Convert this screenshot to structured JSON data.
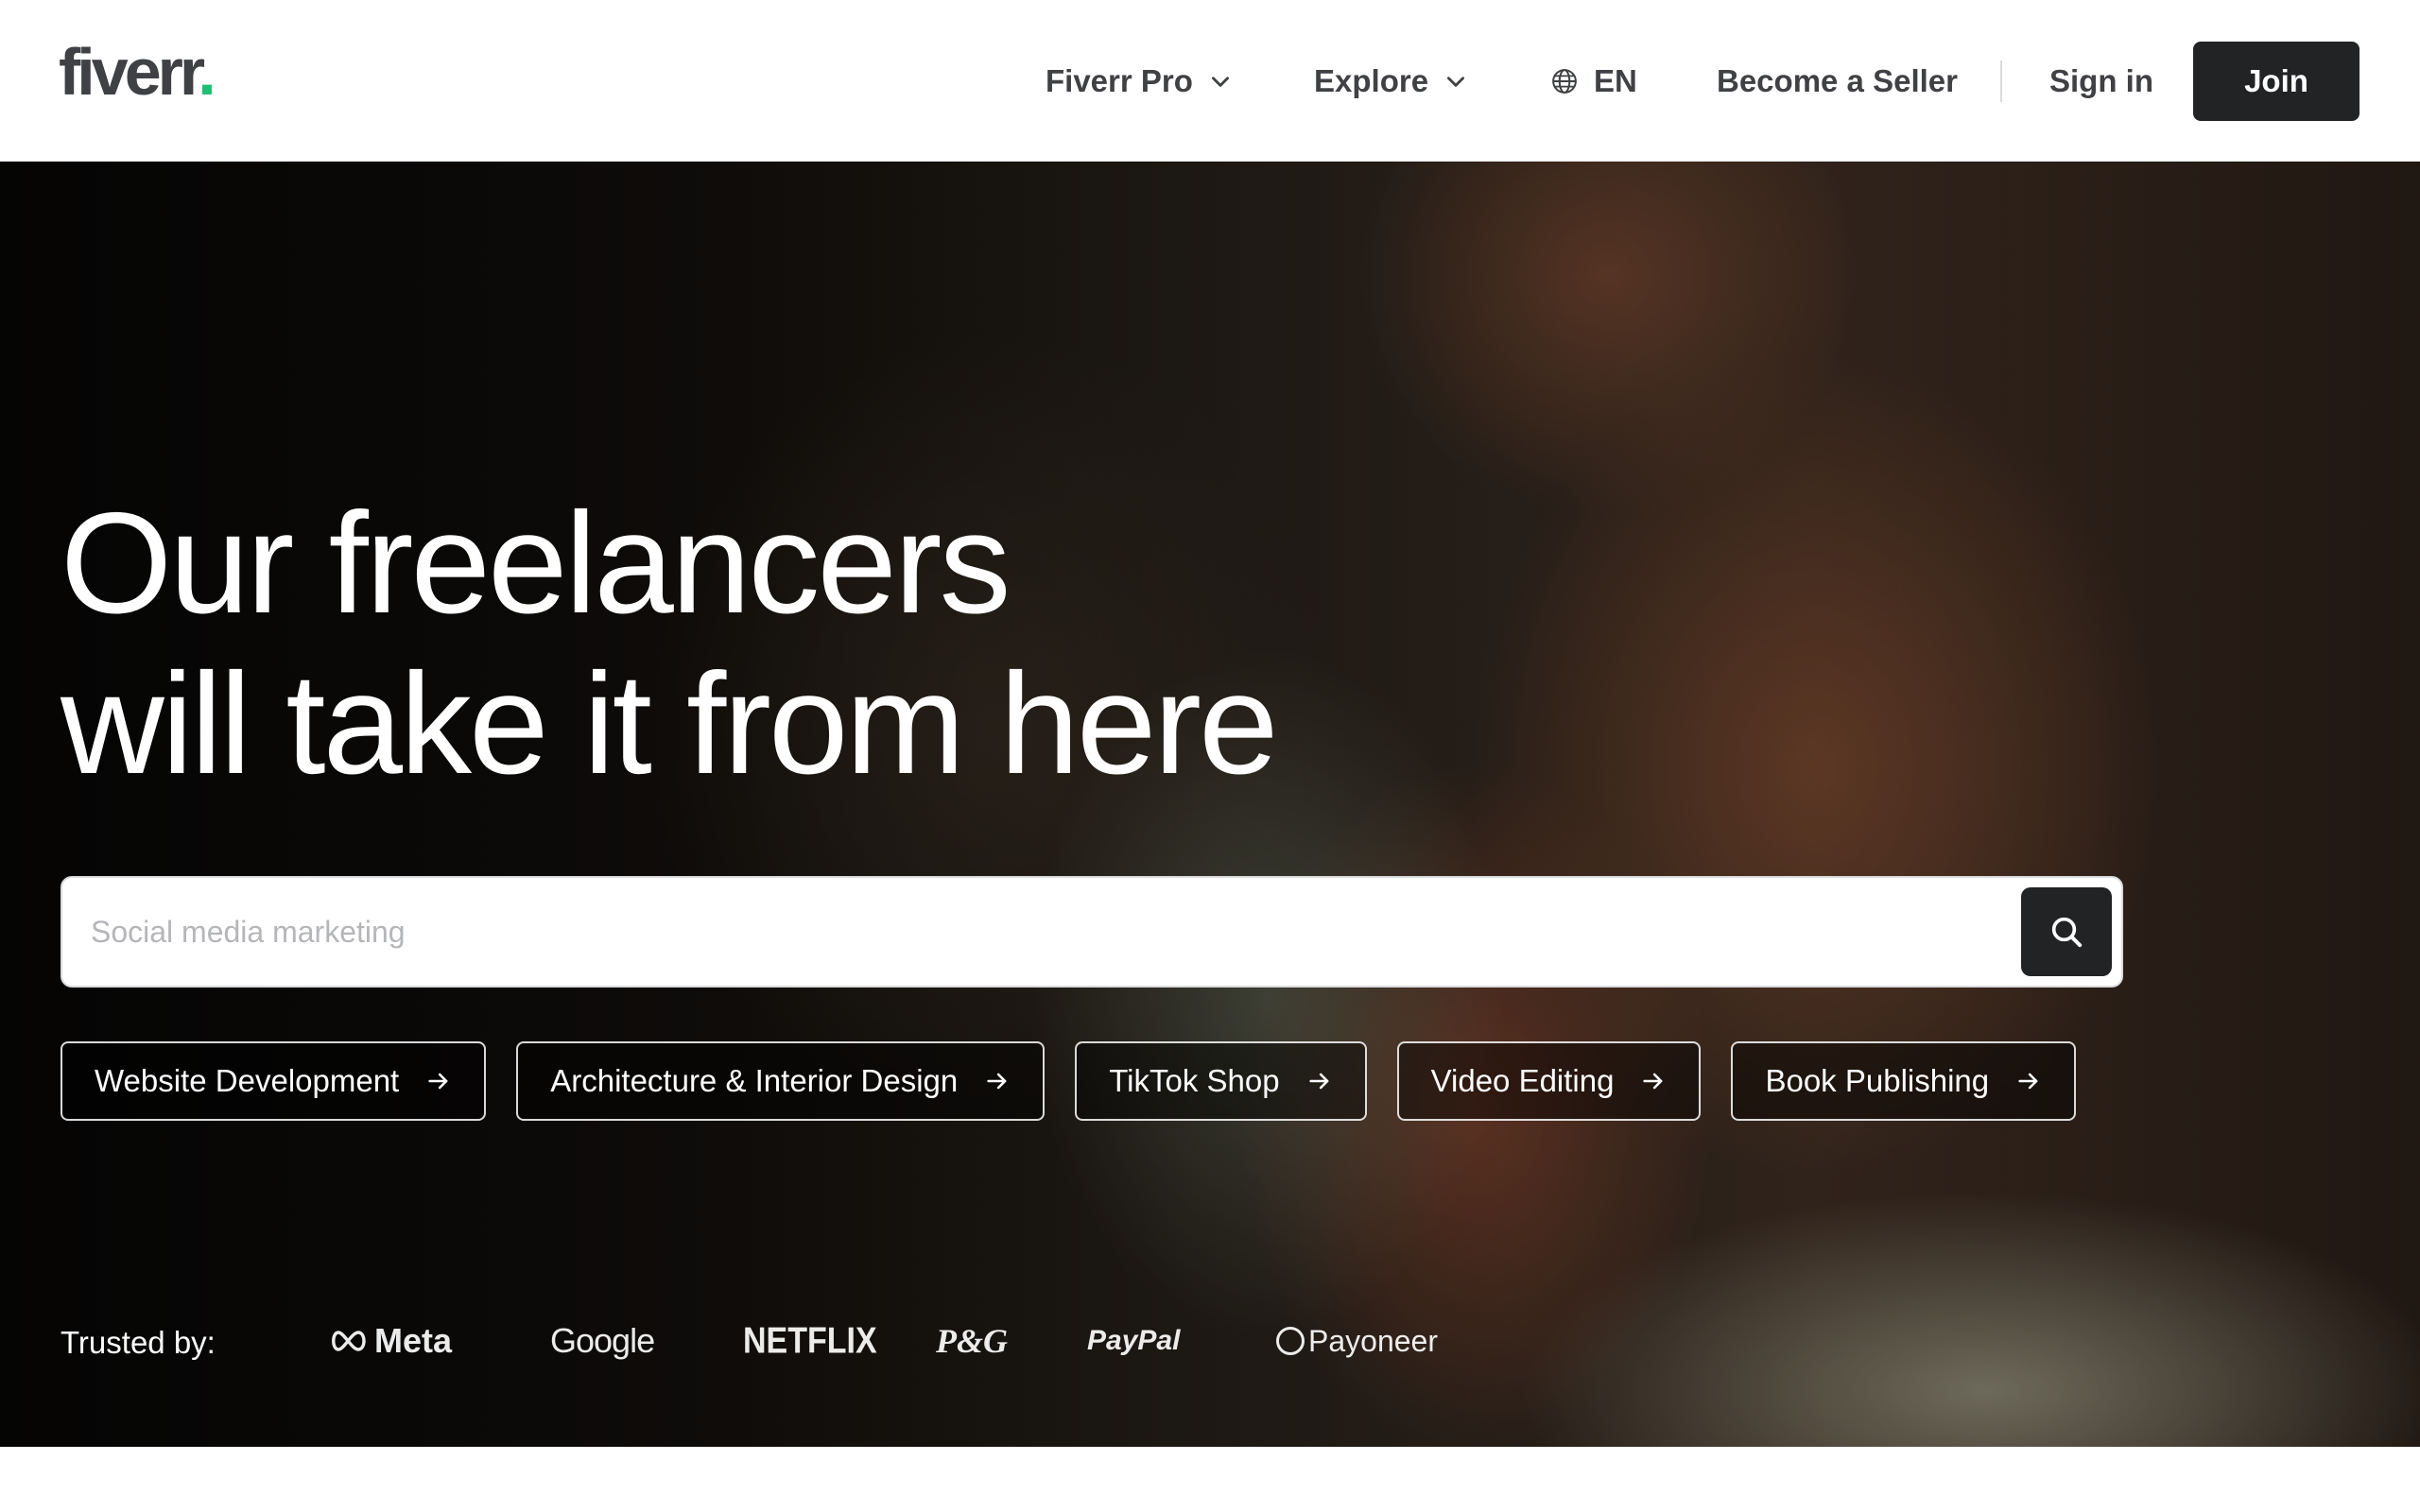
{
  "header": {
    "logo_text": "fiverr",
    "logo_dot": ".",
    "nav": {
      "fiverr_pro": "Fiverr Pro",
      "explore": "Explore",
      "language": "EN",
      "become_seller": "Become a Seller",
      "sign_in": "Sign in",
      "join": "Join"
    }
  },
  "hero": {
    "title_line1": "Our freelancers",
    "title_line2": "will take it from here",
    "search": {
      "placeholder": "Social media marketing",
      "value": ""
    },
    "chips": [
      {
        "label": "Website Development"
      },
      {
        "label": "Architecture & Interior Design"
      },
      {
        "label": "TikTok Shop"
      },
      {
        "label": "Video Editing"
      },
      {
        "label": "Book Publishing"
      }
    ],
    "trusted_label": "Trusted by:",
    "brands": {
      "meta": "Meta",
      "google": "Google",
      "netflix": "NETFLIX",
      "pg": "P&G",
      "paypal": "PayPal",
      "payoneer": "Payoneer"
    }
  },
  "colors": {
    "brand_green": "#1dbf73",
    "dark": "#222325",
    "nav_text": "#404145"
  },
  "icons": {
    "search": "search-icon",
    "chevron": "chevron-down-icon",
    "globe": "globe-icon",
    "arrow": "arrow-right-icon",
    "pause": "pause-icon"
  }
}
